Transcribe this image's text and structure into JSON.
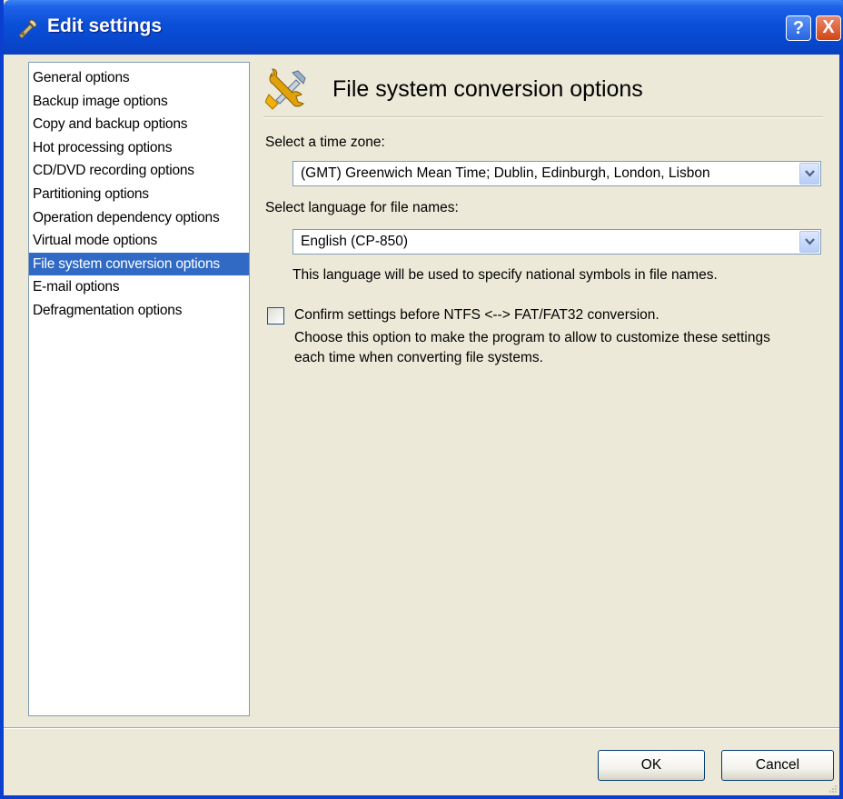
{
  "window": {
    "title": "Edit settings",
    "help_glyph": "?",
    "close_glyph": "X"
  },
  "nav": {
    "items": [
      {
        "label": "General options"
      },
      {
        "label": "Backup image options"
      },
      {
        "label": "Copy and backup options"
      },
      {
        "label": "Hot processing options"
      },
      {
        "label": "CD/DVD recording options"
      },
      {
        "label": "Partitioning options"
      },
      {
        "label": "Operation dependency options"
      },
      {
        "label": "Virtual mode options"
      },
      {
        "label": "File system conversion options",
        "selected": true
      },
      {
        "label": "E-mail options"
      },
      {
        "label": "Defragmentation options"
      }
    ]
  },
  "panel": {
    "icon": "tools-icon",
    "title": "File system conversion options",
    "timezone": {
      "label": "Select a time zone:",
      "value": "(GMT) Greenwich Mean Time; Dublin, Edinburgh, London, Lisbon"
    },
    "language": {
      "label": "Select language for file names:",
      "value": "English (CP-850)",
      "hint": "This language will be used to specify national symbols in file names."
    },
    "confirm": {
      "checked": false,
      "label": "Confirm settings before NTFS <--> FAT/FAT32 conversion.",
      "description_line1": "Choose this option to make the program to allow to customize these settings",
      "description_line2": "each time when converting file systems."
    }
  },
  "buttons": {
    "ok": "OK",
    "cancel": "Cancel"
  },
  "colors": {
    "title_bar": "#0a4fd8",
    "selection": "#316ac5",
    "dialog_bg": "#ece9d8"
  }
}
